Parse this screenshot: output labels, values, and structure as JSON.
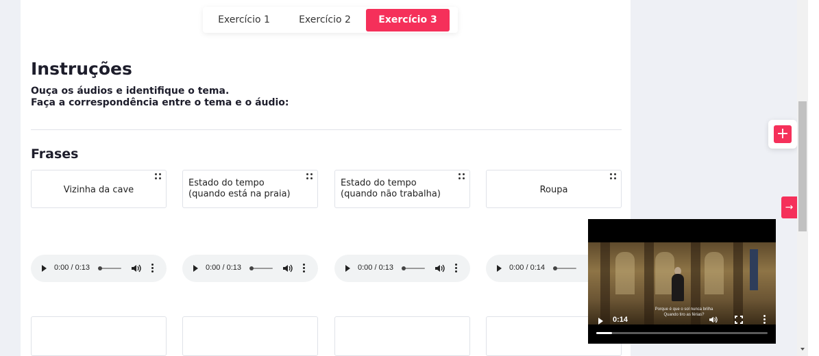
{
  "tabs": [
    {
      "label": "Exercício 1",
      "active": false
    },
    {
      "label": "Exercício 2",
      "active": false
    },
    {
      "label": "Exercício 3",
      "active": true
    }
  ],
  "instructions": {
    "title": "Instruções",
    "line1": "Ouça os áudios e identifique o tema.",
    "line2": "Faça a correspondência entre o tema e o áudio:"
  },
  "phrases": {
    "title": "Frases",
    "cards": [
      {
        "label": "Vizinha da cave"
      },
      {
        "label": "Estado do tempo (quando está na praia)"
      },
      {
        "label": "Estado do tempo (quando não trabalha)"
      },
      {
        "label": "Roupa"
      }
    ]
  },
  "audios": [
    {
      "time": "0:00 / 0:13"
    },
    {
      "time": "0:00 / 0:13"
    },
    {
      "time": "0:00 / 0:13"
    },
    {
      "time": "0:00 / 0:14"
    }
  ],
  "floating": {
    "plus_icon": "+",
    "arrow_icon": "→"
  },
  "video": {
    "time": "0:14",
    "subtitle_line1": "Porque é que o sol nunca brilha",
    "subtitle_line2": "Quando tiro as férias?",
    "progress": 0.09
  },
  "colors": {
    "accent": "#f5305a"
  }
}
